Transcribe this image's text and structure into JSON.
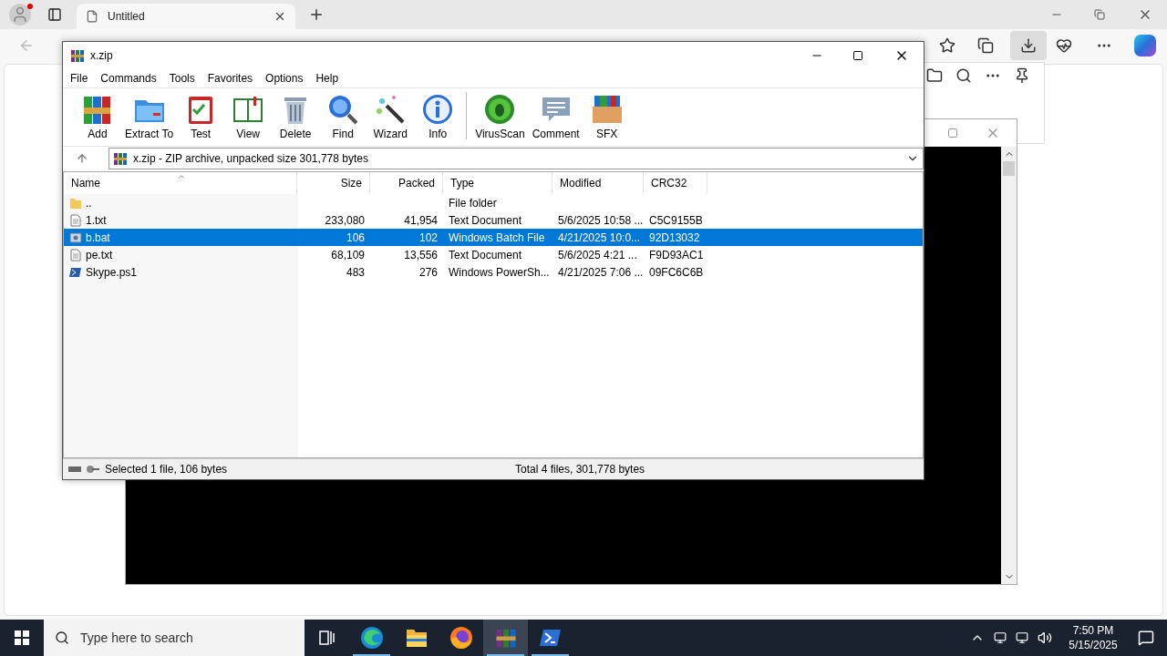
{
  "browser": {
    "tab_title": "Untitled"
  },
  "winrar": {
    "title": "x.zip",
    "menu": [
      "File",
      "Commands",
      "Tools",
      "Favorites",
      "Options",
      "Help"
    ],
    "toolbar": [
      {
        "kind": "add",
        "label": "Add"
      },
      {
        "kind": "extract",
        "label": "Extract To"
      },
      {
        "kind": "test",
        "label": "Test"
      },
      {
        "kind": "view",
        "label": "View"
      },
      {
        "kind": "delete",
        "label": "Delete"
      },
      {
        "kind": "find",
        "label": "Find"
      },
      {
        "kind": "wizard",
        "label": "Wizard"
      },
      {
        "kind": "info",
        "label": "Info"
      },
      {
        "kind": "virusscan",
        "label": "VirusScan"
      },
      {
        "kind": "comment",
        "label": "Comment"
      },
      {
        "kind": "sfx",
        "label": "SFX"
      }
    ],
    "address": "x.zip - ZIP archive, unpacked size 301,778 bytes",
    "columns": [
      "Name",
      "Size",
      "Packed",
      "Type",
      "Modified",
      "CRC32"
    ],
    "rows": [
      {
        "kind": "folder",
        "name": "..",
        "size": "",
        "packed": "",
        "type": "File folder",
        "modified": "",
        "crc": "",
        "selected": false
      },
      {
        "kind": "text",
        "name": "1.txt",
        "size": "233,080",
        "packed": "41,954",
        "type": "Text Document",
        "modified": "5/6/2025 10:58 ...",
        "crc": "C5C9155B",
        "selected": false
      },
      {
        "kind": "batch",
        "name": "b.bat",
        "size": "106",
        "packed": "102",
        "type": "Windows Batch File",
        "modified": "4/21/2025 10:0...",
        "crc": "92D13032",
        "selected": true
      },
      {
        "kind": "text",
        "name": "pe.txt",
        "size": "68,109",
        "packed": "13,556",
        "type": "Text Document",
        "modified": "5/6/2025 4:21 ...",
        "crc": "F9D93AC1",
        "selected": false
      },
      {
        "kind": "powershell",
        "name": "Skype.ps1",
        "size": "483",
        "packed": "276",
        "type": "Windows PowerSh...",
        "modified": "4/21/2025 7:06 ...",
        "crc": "09FC6C6B",
        "selected": false
      }
    ],
    "status_left": "Selected 1 file, 106 bytes",
    "status_right": "Total 4 files, 301,778 bytes"
  },
  "taskbar": {
    "search_placeholder": "Type here to search",
    "apps": [
      {
        "kind": "taskview",
        "running": false,
        "selected": false
      },
      {
        "kind": "edge",
        "running": true,
        "selected": false
      },
      {
        "kind": "explorer",
        "running": false,
        "selected": false
      },
      {
        "kind": "firefox",
        "running": false,
        "selected": false
      },
      {
        "kind": "winrar",
        "running": true,
        "selected": true
      },
      {
        "kind": "powershell",
        "running": true,
        "selected": false
      }
    ],
    "time": "7:50 PM",
    "date": "5/15/2025"
  }
}
